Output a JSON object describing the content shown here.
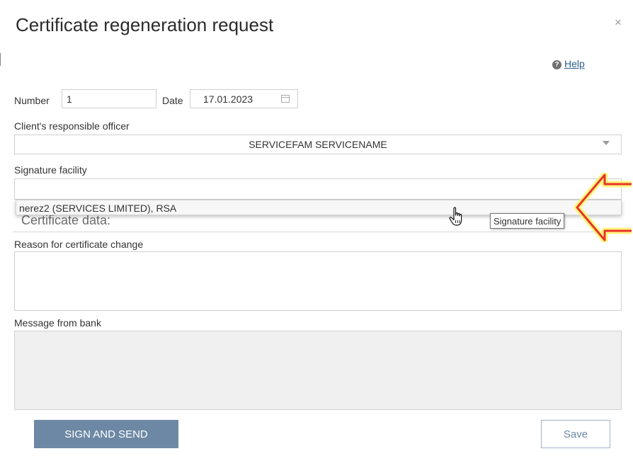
{
  "dialog": {
    "title": "Certificate regeneration request",
    "close_icon": "×",
    "help_label": "Help",
    "help_icon": "?"
  },
  "form": {
    "number_label": "Number",
    "number_value": "1",
    "date_label": "Date",
    "date_value": "17.01.2023",
    "officer_label": "Client's responsible officer",
    "officer_value": "SERVICEFAM SERVICENAME",
    "signature_label": "Signature facility",
    "signature_value": "",
    "signature_option": "nerez2 (SERVICES LIMITED), RSA",
    "signature_tooltip": "Signature facility",
    "certificate_section": "Certificate data:",
    "reason_label": "Reason for certificate change",
    "reason_value": "",
    "message_label": "Message from bank",
    "message_value": ""
  },
  "buttons": {
    "sign_and_send": "SIGN AND SEND",
    "save": "Save"
  },
  "colors": {
    "primary_button": "#6d88a4",
    "link": "#2d5e8c",
    "annotation_arrow_stroke": "#e8332a",
    "annotation_arrow_glow": "#fff56a"
  },
  "icons": [
    "close-icon",
    "help-icon",
    "calendar-icon",
    "chevron-down-icon",
    "hand-pointer-icon",
    "arrow-annotation-icon"
  ]
}
